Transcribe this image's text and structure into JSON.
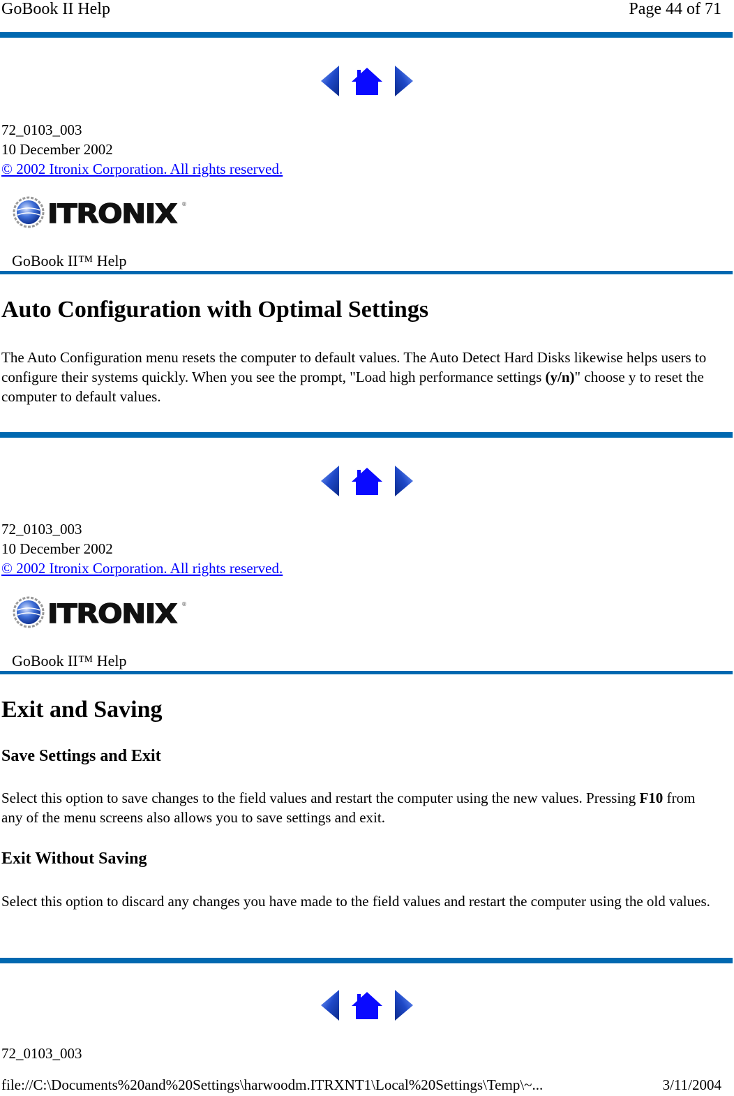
{
  "page_header": {
    "title": "GoBook II Help",
    "page_indicator": "Page 44 of 71"
  },
  "colors": {
    "rule": "#0068b0",
    "link": "#0000ff",
    "nav_icon": "#1f49c8",
    "home_icon": "#0a0aff"
  },
  "nav": {
    "prev_icon": "left-arrow-icon",
    "home_icon": "home-icon",
    "next_icon": "right-arrow-icon"
  },
  "blocks": [
    {
      "doc_id": "72_0103_003",
      "date": "10 December 2002",
      "copyright": "© 2002 Itronix Corporation.  All rights reserved.",
      "logo_text": "ITRONIX",
      "logo_reg": "®",
      "subtitle": "GoBook II™ Help"
    },
    {
      "doc_id": "72_0103_003",
      "date": "10 December 2002",
      "copyright": "© 2002 Itronix Corporation.  All rights reserved.",
      "logo_text": "ITRONIX",
      "logo_reg": "®",
      "subtitle": "GoBook II™ Help"
    }
  ],
  "section1": {
    "heading": "Auto Configuration with Optimal Settings",
    "para_a": "The Auto Configuration menu resets the computer to default values.  The Auto Detect Hard Disks likewise helps users to configure their systems quickly.  When you see the prompt, \"Load high performance settings ",
    "para_bold": "(y/n)",
    "para_b": "\" choose y to reset the computer to default values."
  },
  "section2": {
    "heading": "Exit and Saving",
    "sub1": {
      "heading": "Save Settings and Exit",
      "para_a": "Select this option to save changes to the field values and restart the computer using the new values.  Pressing ",
      "para_bold": "F10",
      "para_b": " from any of the menu screens also allows you to save settings and exit."
    },
    "sub2": {
      "heading": "Exit Without Saving",
      "para": "Select this option to discard any changes you have made to the field values and restart the computer using the old values."
    }
  },
  "final_block": {
    "doc_id": "72_0103_003"
  },
  "page_footer": {
    "path": "file://C:\\Documents%20and%20Settings\\harwoodm.ITRXNT1\\Local%20Settings\\Temp\\~...",
    "date": "3/11/2004"
  }
}
